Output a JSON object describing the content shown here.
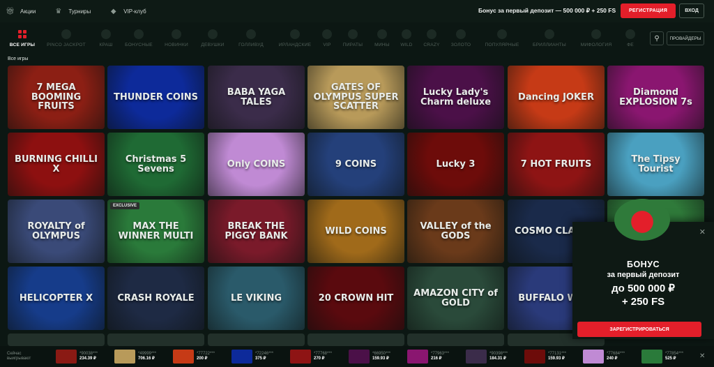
{
  "topbar": {
    "links": [
      {
        "label": "Акции",
        "icon": "gift-icon"
      },
      {
        "label": "Турниры",
        "icon": "trophy-icon"
      },
      {
        "label": "VIP-клуб",
        "icon": "diamond-icon"
      }
    ],
    "promo": "Бонус за первый депозит — 500 000 ₽ + 250 FS",
    "register_label": "РЕГИСТРАЦИЯ",
    "login_label": "ВХОД"
  },
  "categories": [
    "ВСЕ ИГРЫ",
    "PINCO JACKPOT",
    "КРАШ",
    "БОНУСНЫЕ",
    "НОВИНКИ",
    "ДЕВУШКИ",
    "ГОЛЛИВУД",
    "ИРЛАНДСКИЕ",
    "VIP",
    "ПИРАТЫ",
    "МИНЫ",
    "WILD",
    "CRAZY",
    "ЗОЛОТО",
    "ПОПУЛЯРНЫЕ",
    "БРИЛЛИАНТЫ",
    "МИФОЛОГИЯ",
    "ФЕ"
  ],
  "providers_label": "ПРОВАЙДЕРЫ",
  "section_title": "Все игры",
  "games": [
    {
      "title": "7 MEGA BOOMING FRUITS",
      "color": "#8c1f14"
    },
    {
      "title": "THUNDER COINS",
      "color": "#0d2a9a"
    },
    {
      "title": "BABA YAGA TALES",
      "color": "#3b2c4a"
    },
    {
      "title": "GATES OF OLYMPUS SUPER SCATTER",
      "color": "#b89a5a"
    },
    {
      "title": "Lucky Lady's Charm deluxe",
      "color": "#4b1048"
    },
    {
      "title": "Dancing JOKER",
      "color": "#c63a16"
    },
    {
      "title": "Diamond EXPLOSION 7s",
      "color": "#8a1670"
    },
    {
      "title": "BURNING CHILLI X",
      "color": "#8d1010"
    },
    {
      "title": "Christmas 5 Sevens",
      "color": "#1f6a34"
    },
    {
      "title": "Only COINS",
      "color": "#c08ad4"
    },
    {
      "title": "9 COINS",
      "color": "#24407a"
    },
    {
      "title": "Lucky 3",
      "color": "#6d0c0a"
    },
    {
      "title": "7 HOT FRUITS",
      "color": "#8e1414"
    },
    {
      "title": "The Tipsy Tourist",
      "color": "#4aa0c0"
    },
    {
      "title": "ROYALTY of OLYMPUS",
      "color": "#3a4a78"
    },
    {
      "title": "MAX THE WINNER MULTI",
      "color": "#2a7a3a",
      "badge": "EXCLUSIVE"
    },
    {
      "title": "BREAK THE PIGGY BANK",
      "color": "#7a1a2a"
    },
    {
      "title": "WILD COINS",
      "color": "#a06a1a"
    },
    {
      "title": "VALLEY of the GODS",
      "color": "#6a3a1a"
    },
    {
      "title": "COSMO CLASSIC",
      "color": "#1a2a4a"
    },
    {
      "title": "",
      "color": "#2f7a3a"
    },
    {
      "title": "HELICOPTER X",
      "color": "#163c8a"
    },
    {
      "title": "CRASH ROYALE",
      "color": "#1e2a44"
    },
    {
      "title": "LE VIKING",
      "color": "#2a5a6a"
    },
    {
      "title": "20 CROWN HIT",
      "color": "#5a0a0e"
    },
    {
      "title": "AMAZON CITY of GOLD",
      "color": "#2a4a3a"
    },
    {
      "title": "BUFFALO WILD",
      "color": "#2a3a7a"
    }
  ],
  "popup": {
    "line1": "БОНУС",
    "line2": "за первый депозит",
    "line3": "до 500 000 ₽",
    "line4": "+ 250 FS",
    "button_label": "ЗАРЕГИСТРИРОВАТЬСЯ"
  },
  "ticker": {
    "label": "Сейчас выигрывают",
    "items": [
      {
        "user": "*90038***",
        "amount": "234.39 ₽",
        "color": "#8a1a14"
      },
      {
        "user": "*49999***",
        "amount": "706.16 ₽",
        "color": "#b89a5a"
      },
      {
        "user": "*77722***",
        "amount": "200 ₽",
        "color": "#c63a16"
      },
      {
        "user": "*72246***",
        "amount": "375 ₽",
        "color": "#0d2a9a"
      },
      {
        "user": "*77768***",
        "amount": "270 ₽",
        "color": "#8e1414"
      },
      {
        "user": "*66950***",
        "amount": "159.93 ₽",
        "color": "#4b1048"
      },
      {
        "user": "*77963***",
        "amount": "216 ₽",
        "color": "#8a1670"
      },
      {
        "user": "*90398***",
        "amount": "184.31 ₽",
        "color": "#3b2c4a"
      },
      {
        "user": "*77131***",
        "amount": "159.93 ₽",
        "color": "#6d0c0a"
      },
      {
        "user": "*77684***",
        "amount": "240 ₽",
        "color": "#c08ad4"
      },
      {
        "user": "*77854***",
        "amount": "525 ₽",
        "color": "#2a7a3a"
      }
    ]
  }
}
